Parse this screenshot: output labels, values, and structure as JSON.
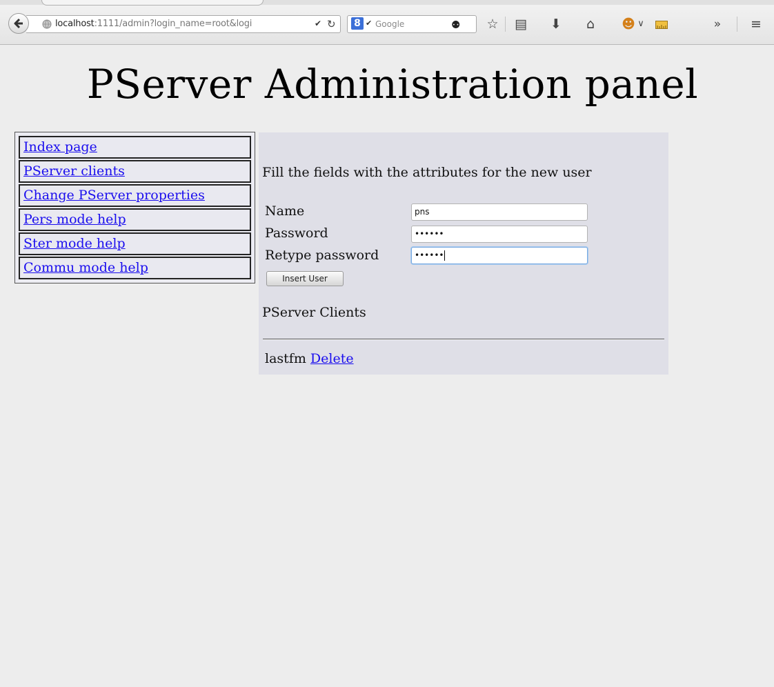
{
  "browser": {
    "url_host": "localhost",
    "url_rest": ":1111/admin?login_name=root&logi",
    "search_placeholder": "Google",
    "search_engine_glyph": "8",
    "icons": [
      "back-arrow-icon",
      "globe-icon",
      "history-dropdown-icon",
      "reload-icon",
      "google-engine-icon",
      "search-icon",
      "bookmark-star-icon",
      "reading-list-icon",
      "download-icon",
      "home-icon",
      "addon-face-icon",
      "addon-dropdown-icon",
      "ruler-addon-icon",
      "overflow-chevron-icon",
      "hamburger-menu-icon"
    ]
  },
  "page": {
    "title": "PServer Administration panel"
  },
  "nav": {
    "items": [
      {
        "label": "Index page"
      },
      {
        "label": "PServer clients"
      },
      {
        "label": "Change PServer properties"
      },
      {
        "label": "Pers mode help"
      },
      {
        "label": "Ster mode help"
      },
      {
        "label": "Commu mode help"
      }
    ]
  },
  "form": {
    "intro": "Fill the fields with the attributes for the new user",
    "name_label": "Name",
    "name_value": "pns",
    "password_label": "Password",
    "password_value": "••••••",
    "retype_label": "Retype password",
    "retype_value": "••••••",
    "submit_label": "Insert User"
  },
  "clients": {
    "heading": "PServer Clients",
    "rows": [
      {
        "name": "lastfm",
        "action": "Delete"
      }
    ]
  },
  "colors": {
    "link": "#1a0dee",
    "page_bg": "#ededed",
    "panel_bg": "#dfdfe7",
    "focus_ring": "#78a8e0"
  }
}
